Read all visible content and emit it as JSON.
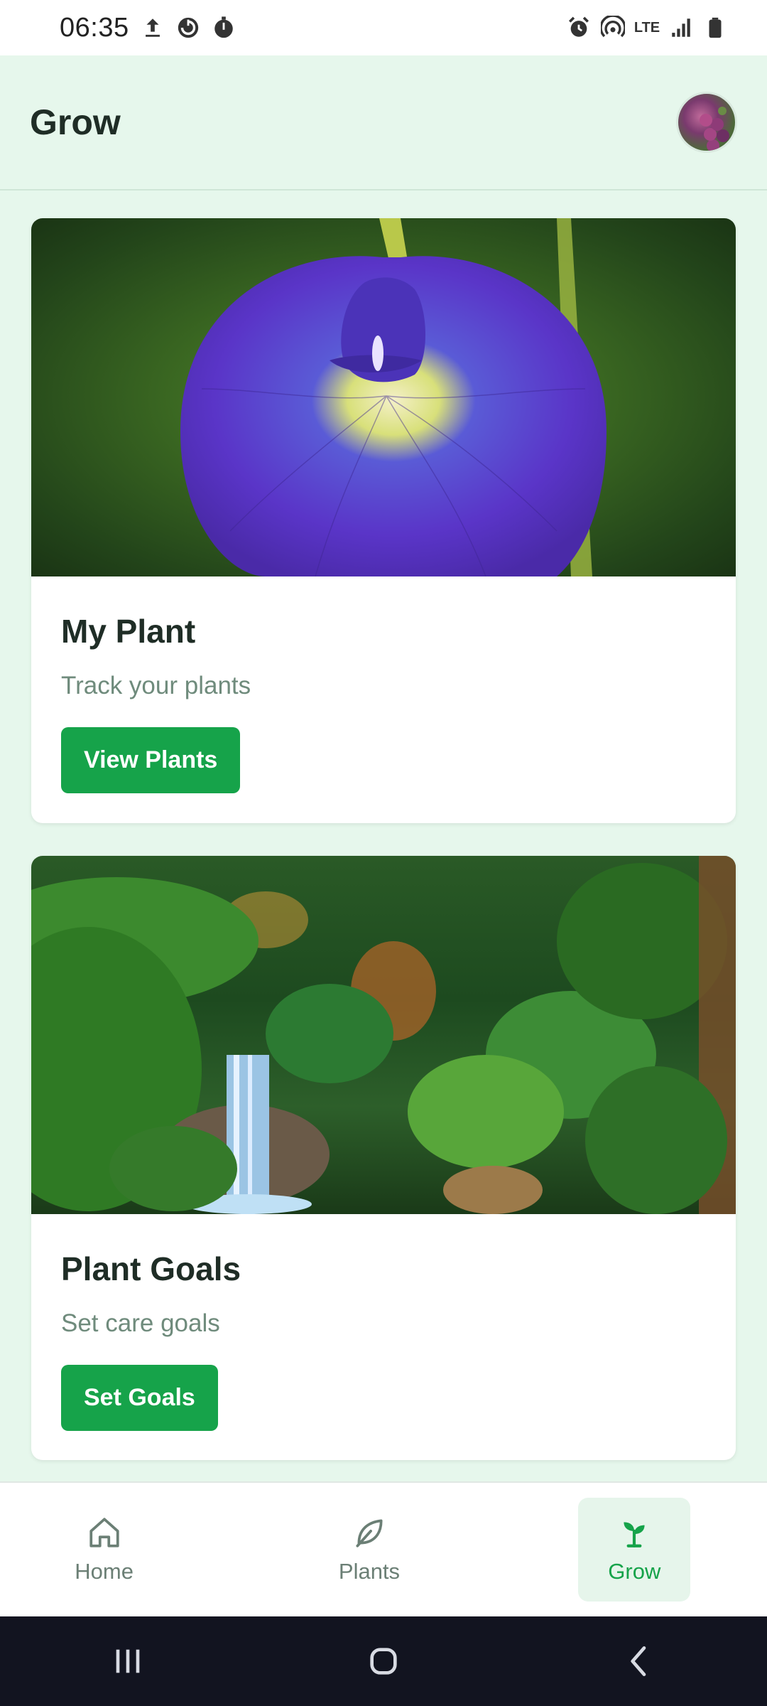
{
  "status_bar": {
    "time": "06:35",
    "left_icons": [
      "upload-icon",
      "data-saver-icon",
      "timer-icon"
    ],
    "right_icons": [
      "alarm-icon",
      "hotspot-icon",
      "lte-icon",
      "signal-icon",
      "battery-icon"
    ],
    "lte_label": "LTE"
  },
  "header": {
    "title": "Grow",
    "avatar_icon": "profile-avatar"
  },
  "cards": [
    {
      "title": "My Plant",
      "subtitle": "Track your plants",
      "button_label": "View Plants",
      "image": "blue butterfly pea flower"
    },
    {
      "title": "Plant Goals",
      "subtitle": "Set care goals",
      "button_label": "Set Goals",
      "image": "jungle garden with waterfall"
    }
  ],
  "bottom_nav": {
    "items": [
      {
        "label": "Home",
        "icon": "home-icon",
        "active": false
      },
      {
        "label": "Plants",
        "icon": "leaf-icon",
        "active": false
      },
      {
        "label": "Grow",
        "icon": "sprout-icon",
        "active": true
      }
    ]
  },
  "system_nav": {
    "buttons": [
      "recent-apps-icon",
      "home-circle-icon",
      "back-icon"
    ]
  },
  "colors": {
    "background": "#e6f7ec",
    "accent": "#16a34a",
    "card": "#ffffff",
    "system_nav": "#121420"
  }
}
